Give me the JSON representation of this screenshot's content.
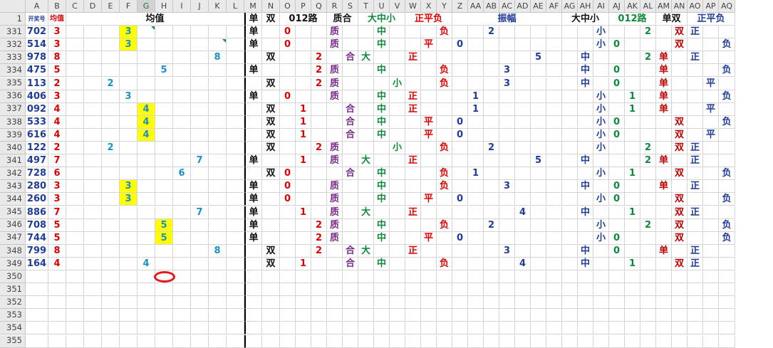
{
  "sheet": {
    "columns": [
      "A",
      "B",
      "C",
      "D",
      "E",
      "F",
      "G",
      "H",
      "I",
      "J",
      "K",
      "L",
      "M",
      "N",
      "O",
      "P",
      "Q",
      "R",
      "S",
      "T",
      "U",
      "V",
      "W",
      "X",
      "Y",
      "Z",
      "AA",
      "AB",
      "AC",
      "AD",
      "AE",
      "AF",
      "AG",
      "AH",
      "AI",
      "AJ",
      "AK",
      "AL",
      "AM",
      "AN",
      "AO",
      "AP",
      "AQ"
    ],
    "selected_column": "G",
    "row1": {
      "row_number": "1",
      "A": "开奖号",
      "B": "均值",
      "avg_group": "均值",
      "M": "单",
      "N": "双",
      "route_group": "012路",
      "prime_group": "质合",
      "size_group": "大中小",
      "sign_group": "正平负",
      "amp_group": "振幅",
      "size2_group": "大中小",
      "route2_group": "012路",
      "oddeven2_group": "单双",
      "sign2_group": "正平负"
    },
    "rows": [
      {
        "r": "331",
        "A": "702",
        "B": "3",
        "avg": "3",
        "avgcol": "F",
        "hl": true,
        "M": "单",
        "N": "",
        "route": "0",
        "prime": "质",
        "size": "中",
        "sign": "负",
        "amp": "2",
        "size2": "小",
        "route2": "2",
        "oe2": "双",
        "sign2": "正"
      },
      {
        "r": "332",
        "A": "514",
        "B": "3",
        "avg": "3",
        "avgcol": "F",
        "hl": true,
        "M": "单",
        "N": "",
        "route": "0",
        "prime": "质",
        "size": "中",
        "sign": "平",
        "amp": "0",
        "size2": "小",
        "route2": "0",
        "oe2": "双",
        "sign2": "负"
      },
      {
        "r": "333",
        "A": "978",
        "B": "8",
        "avg": "8",
        "avgcol": "K",
        "hl": false,
        "M": "",
        "N": "双",
        "route": "2",
        "prime": "合",
        "size": "大",
        "sign": "正",
        "amp": "5",
        "size2": "中",
        "route2": "2",
        "oe2": "单",
        "sign2": "正"
      },
      {
        "r": "334",
        "A": "475",
        "B": "5",
        "avg": "5",
        "avgcol": "H",
        "hl": false,
        "M": "单",
        "N": "",
        "route": "2",
        "prime": "质",
        "size": "中",
        "sign": "负",
        "amp": "3",
        "size2": "中",
        "route2": "0",
        "oe2": "单",
        "sign2": "负"
      },
      {
        "r": "335",
        "A": "113",
        "B": "2",
        "avg": "2",
        "avgcol": "E",
        "hl": false,
        "M": "",
        "N": "双",
        "route": "2",
        "prime": "质",
        "size": "小",
        "sign": "负",
        "amp": "3",
        "size2": "中",
        "route2": "0",
        "oe2": "单",
        "sign2": "平"
      },
      {
        "r": "336",
        "A": "406",
        "B": "3",
        "avg": "3",
        "avgcol": "F",
        "hl": false,
        "M": "单",
        "N": "",
        "route": "0",
        "prime": "质",
        "size": "中",
        "sign": "正",
        "amp": "1",
        "size2": "小",
        "route2": "1",
        "oe2": "单",
        "sign2": "负"
      },
      {
        "r": "337",
        "A": "092",
        "B": "4",
        "avg": "4",
        "avgcol": "G",
        "hl": true,
        "M": "",
        "N": "双",
        "route": "1",
        "prime": "合",
        "size": "中",
        "sign": "正",
        "amp": "1",
        "size2": "小",
        "route2": "1",
        "oe2": "单",
        "sign2": "平"
      },
      {
        "r": "338",
        "A": "533",
        "B": "4",
        "avg": "4",
        "avgcol": "G",
        "hl": true,
        "M": "",
        "N": "双",
        "route": "1",
        "prime": "合",
        "size": "中",
        "sign": "平",
        "amp": "0",
        "size2": "小",
        "route2": "0",
        "oe2": "双",
        "sign2": "负"
      },
      {
        "r": "339",
        "A": "616",
        "B": "4",
        "avg": "4",
        "avgcol": "G",
        "hl": true,
        "M": "",
        "N": "双",
        "route": "1",
        "prime": "合",
        "size": "中",
        "sign": "平",
        "amp": "0",
        "size2": "小",
        "route2": "0",
        "oe2": "双",
        "sign2": "平"
      },
      {
        "r": "340",
        "A": "122",
        "B": "2",
        "avg": "2",
        "avgcol": "E",
        "hl": false,
        "M": "",
        "N": "双",
        "route": "2",
        "prime": "质",
        "size": "小",
        "sign": "负",
        "amp": "2",
        "size2": "小",
        "route2": "2",
        "oe2": "双",
        "sign2": "正"
      },
      {
        "r": "341",
        "A": "497",
        "B": "7",
        "avg": "7",
        "avgcol": "J",
        "hl": false,
        "M": "单",
        "N": "",
        "route": "1",
        "prime": "质",
        "size": "大",
        "sign": "正",
        "amp": "5",
        "size2": "中",
        "route2": "2",
        "oe2": "单",
        "sign2": "正"
      },
      {
        "r": "342",
        "A": "728",
        "B": "6",
        "avg": "6",
        "avgcol": "I",
        "hl": false,
        "M": "",
        "N": "双",
        "route": "0",
        "prime": "合",
        "size": "中",
        "sign": "负",
        "amp": "1",
        "size2": "小",
        "route2": "1",
        "oe2": "双",
        "sign2": "负"
      },
      {
        "r": "343",
        "A": "280",
        "B": "3",
        "avg": "3",
        "avgcol": "F",
        "hl": true,
        "M": "单",
        "N": "",
        "route": "0",
        "prime": "质",
        "size": "中",
        "sign": "负",
        "amp": "3",
        "size2": "中",
        "route2": "0",
        "oe2": "单",
        "sign2": "正"
      },
      {
        "r": "344",
        "A": "260",
        "B": "3",
        "avg": "3",
        "avgcol": "F",
        "hl": true,
        "M": "单",
        "N": "",
        "route": "0",
        "prime": "质",
        "size": "中",
        "sign": "平",
        "amp": "0",
        "size2": "小",
        "route2": "0",
        "oe2": "双",
        "sign2": "负"
      },
      {
        "r": "345",
        "A": "886",
        "B": "7",
        "avg": "7",
        "avgcol": "J",
        "hl": false,
        "M": "单",
        "N": "",
        "route": "1",
        "prime": "质",
        "size": "大",
        "sign": "正",
        "amp": "4",
        "size2": "中",
        "route2": "1",
        "oe2": "双",
        "sign2": "正"
      },
      {
        "r": "346",
        "A": "708",
        "B": "5",
        "avg": "5",
        "avgcol": "H",
        "hl": true,
        "M": "单",
        "N": "",
        "route": "2",
        "prime": "质",
        "size": "中",
        "sign": "负",
        "amp": "2",
        "size2": "小",
        "route2": "2",
        "oe2": "双",
        "sign2": "负"
      },
      {
        "r": "347",
        "A": "744",
        "B": "5",
        "avg": "5",
        "avgcol": "H",
        "hl": true,
        "M": "单",
        "N": "",
        "route": "2",
        "prime": "质",
        "size": "中",
        "sign": "平",
        "amp": "0",
        "size2": "小",
        "route2": "0",
        "oe2": "双",
        "sign2": "负"
      },
      {
        "r": "348",
        "A": "799",
        "B": "8",
        "avg": "8",
        "avgcol": "K",
        "hl": false,
        "M": "",
        "N": "双",
        "route": "2",
        "prime": "合",
        "size": "大",
        "sign": "正",
        "amp": "3",
        "size2": "中",
        "route2": "0",
        "oe2": "单",
        "sign2": "正"
      },
      {
        "r": "349",
        "A": "164",
        "B": "4",
        "avg": "4",
        "avgcol": "G",
        "hl": false,
        "M": "",
        "N": "双",
        "route": "1",
        "prime": "合",
        "size": "中",
        "sign": "负",
        "amp": "4",
        "size2": "中",
        "route2": "1",
        "oe2": "双",
        "sign2": "正"
      }
    ],
    "empty_rows": [
      "350",
      "351",
      "352",
      "353",
      "354",
      "355"
    ],
    "colors": {
      "highlight": "#ffff00",
      "draw_number": "#1f3c99",
      "average": "#e00000",
      "average_position": "#1a90c8",
      "prime": "#7a2a8a",
      "size": "#0a8a3a",
      "sign": "#e00000",
      "annotation_oval": "#e8151b"
    }
  }
}
